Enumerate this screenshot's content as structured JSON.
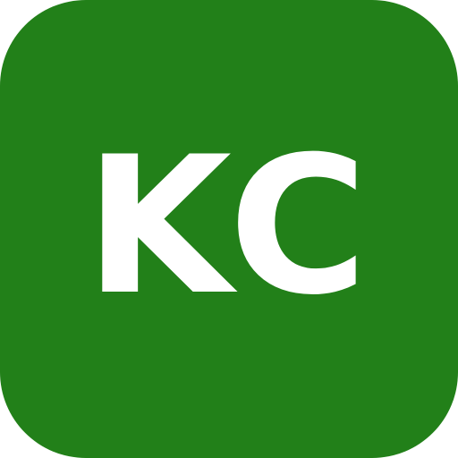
{
  "app_icon": {
    "initials": "KC",
    "background_color": "#228019",
    "text_color": "#ffffff"
  }
}
